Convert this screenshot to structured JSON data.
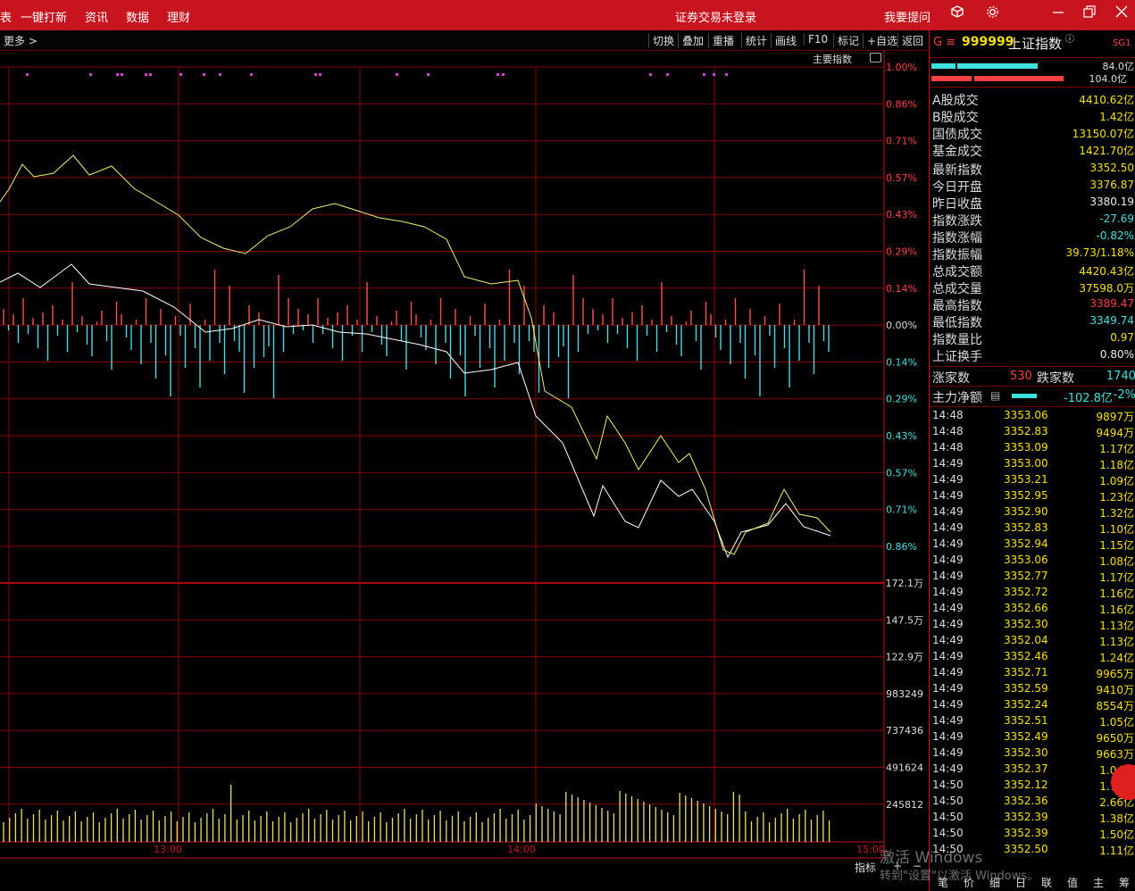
{
  "titlebar": {
    "menus": [
      "一键打新",
      "资讯",
      "数据",
      "理财"
    ],
    "left_fragment": "表",
    "center": "证券交易未登录",
    "help": "我要提问",
    "icons": [
      "cube-icon",
      "gear-icon",
      "minimize-icon",
      "restore-icon",
      "close-icon"
    ]
  },
  "toolbar": {
    "more": "更多 >",
    "buttons": [
      "切换",
      "叠加",
      "重播",
      "统计",
      "画线",
      "F10",
      "标记",
      "+自选",
      "返回"
    ],
    "main_index_label": "主要指数"
  },
  "chart": {
    "pct_ticks": [
      "1.00%",
      "0.86%",
      "0.71%",
      "0.57%",
      "0.43%",
      "0.29%",
      "0.14%",
      "0.00%",
      "0.14%",
      "0.29%",
      "0.43%",
      "0.57%",
      "0.71%",
      "0.86%"
    ],
    "vol_ticks": [
      "172.1万",
      "147.5万",
      "122.9万",
      "983249",
      "737436",
      "491624",
      "245812"
    ],
    "time_labels": [
      "13:00",
      "14:00",
      "15:00"
    ],
    "bottom_buttons": [
      "指标",
      "+",
      "−"
    ],
    "colors": {
      "grid": "#8c0000",
      "price_line": "#ffffff",
      "avg_line": "#f0f070",
      "up_bar": "#ff5050",
      "down_bar": "#50d8e0",
      "vol_bar": "#e8e070"
    }
  },
  "side": {
    "prefix": "G ≡",
    "code": "999999",
    "name": "上证指数",
    "badge": "SG1",
    "bar_top_value": "84.0亿",
    "bar_bottom_value": "104.0亿",
    "turnover": [
      {
        "k": "A股成交",
        "v": "4410.62亿"
      },
      {
        "k": "B股成交",
        "v": "1.42亿"
      },
      {
        "k": "国债成交",
        "v": "13150.07亿"
      },
      {
        "k": "基金成交",
        "v": "1421.70亿"
      }
    ],
    "stats": [
      {
        "k": "最新指数",
        "v": "3352.50"
      },
      {
        "k": "今日开盘",
        "v": "3376.87"
      },
      {
        "k": "昨日收盘",
        "v": "3380.19"
      },
      {
        "k": "指数涨跌",
        "v": "-27.69"
      },
      {
        "k": "指数涨幅",
        "v": "-0.82%"
      },
      {
        "k": "指数振幅",
        "v": "39.73/1.18%"
      },
      {
        "k": "总成交额",
        "v": "4420.43亿"
      },
      {
        "k": "总成交量",
        "v": "37598.0万"
      },
      {
        "k": "最高指数",
        "v": "3389.47"
      },
      {
        "k": "最低指数",
        "v": "3349.74"
      },
      {
        "k": "指数量比",
        "v": "0.97"
      },
      {
        "k": "上证换手",
        "v": "0.80%"
      }
    ],
    "up_label": "涨家数",
    "up_count": "530",
    "down_label": "跌家数",
    "down_count": "1740",
    "main_flow_label": "主力净额",
    "main_flow_value": "-102.8亿",
    "main_flow_pct": "-2%",
    "ticks": [
      [
        "14:48",
        "3353.06",
        "9897万"
      ],
      [
        "14:48",
        "3352.83",
        "9494万"
      ],
      [
        "14:48",
        "3353.09",
        "1.17亿"
      ],
      [
        "14:49",
        "3353.00",
        "1.18亿"
      ],
      [
        "14:49",
        "3353.21",
        "1.09亿"
      ],
      [
        "14:49",
        "3352.95",
        "1.23亿"
      ],
      [
        "14:49",
        "3352.90",
        "1.32亿"
      ],
      [
        "14:49",
        "3352.83",
        "1.10亿"
      ],
      [
        "14:49",
        "3352.94",
        "1.15亿"
      ],
      [
        "14:49",
        "3353.06",
        "1.08亿"
      ],
      [
        "14:49",
        "3352.77",
        "1.17亿"
      ],
      [
        "14:49",
        "3352.72",
        "1.16亿"
      ],
      [
        "14:49",
        "3352.66",
        "1.16亿"
      ],
      [
        "14:49",
        "3352.30",
        "1.13亿"
      ],
      [
        "14:49",
        "3352.04",
        "1.13亿"
      ],
      [
        "14:49",
        "3352.46",
        "1.24亿"
      ],
      [
        "14:49",
        "3352.71",
        "9965万"
      ],
      [
        "14:49",
        "3352.59",
        "9410万"
      ],
      [
        "14:49",
        "3352.24",
        "8554万"
      ],
      [
        "14:49",
        "3352.51",
        "1.05亿"
      ],
      [
        "14:49",
        "3352.49",
        "9650万"
      ],
      [
        "14:49",
        "3352.30",
        "9663万"
      ],
      [
        "14:49",
        "3352.37",
        "1.04亿"
      ],
      [
        "14:50",
        "3352.12",
        "1.76亿"
      ],
      [
        "14:50",
        "3352.36",
        "2.66亿"
      ],
      [
        "14:50",
        "3352.39",
        "1.38亿"
      ],
      [
        "14:50",
        "3352.39",
        "1.50亿"
      ],
      [
        "14:50",
        "3352.50",
        "1.11亿"
      ]
    ],
    "bottom_tabs": [
      "笔",
      "价",
      "细",
      "日",
      "联",
      "值",
      "主",
      "筹"
    ]
  },
  "watermark": {
    "line1": "激活 Windows",
    "line2": "转到\"设置\"以激活 Windows。"
  }
}
